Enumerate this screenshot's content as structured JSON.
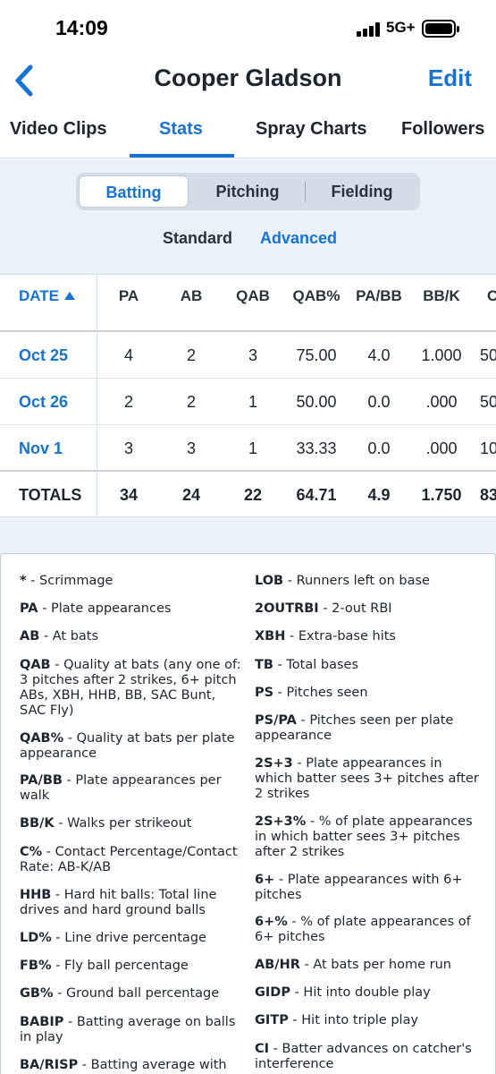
{
  "status_bar": {
    "time": "14:09",
    "network": "5G+"
  },
  "nav": {
    "title": "Cooper Gladson",
    "edit_label": "Edit"
  },
  "tabs": [
    {
      "label": "Video Clips",
      "active": false
    },
    {
      "label": "Stats",
      "active": true
    },
    {
      "label": "Spray Charts",
      "active": false
    },
    {
      "label": "Followers",
      "active": false
    }
  ],
  "stat_types": [
    {
      "label": "Batting",
      "active": true
    },
    {
      "label": "Pitching",
      "active": false
    },
    {
      "label": "Fielding",
      "active": false
    }
  ],
  "modes": {
    "standard": "Standard",
    "advanced": "Advanced",
    "active": "Advanced"
  },
  "table": {
    "columns": [
      "DATE",
      "PA",
      "AB",
      "QAB",
      "QAB%",
      "PA/BB",
      "BB/K",
      "C"
    ],
    "rows": [
      [
        "Oct 25",
        "4",
        "2",
        "3",
        "75.00",
        "4.0",
        "1.000",
        "50"
      ],
      [
        "Oct 26",
        "2",
        "2",
        "1",
        "50.00",
        "0.0",
        ".000",
        "50"
      ],
      [
        "Nov 1",
        "3",
        "3",
        "1",
        "33.33",
        "0.0",
        ".000",
        "10"
      ]
    ],
    "totals": [
      "TOTALS",
      "34",
      "24",
      "22",
      "64.71",
      "4.9",
      "1.750",
      "83"
    ]
  },
  "glossary": {
    "left": [
      {
        "term": "*",
        "def": "Scrimmage"
      },
      {
        "term": "PA",
        "def": "Plate appearances"
      },
      {
        "term": "AB",
        "def": "At bats"
      },
      {
        "term": "QAB",
        "def": "Quality at bats (any one of: 3 pitches after 2 strikes, 6+ pitch ABs, XBH, HHB, BB, SAC Bunt, SAC Fly)"
      },
      {
        "term": "QAB%",
        "def": "Quality at bats per plate appearance"
      },
      {
        "term": "PA/BB",
        "def": "Plate appearances per walk"
      },
      {
        "term": "BB/K",
        "def": "Walks per strikeout"
      },
      {
        "term": "C%",
        "def": "Contact Percentage/Contact Rate: AB-K/AB"
      },
      {
        "term": "HHB",
        "def": "Hard hit balls: Total line drives and hard ground balls"
      },
      {
        "term": "LD%",
        "def": "Line drive percentage"
      },
      {
        "term": "FB%",
        "def": "Fly ball percentage"
      },
      {
        "term": "GB%",
        "def": "Ground ball percentage"
      },
      {
        "term": "BABIP",
        "def": "Batting average on balls in play"
      },
      {
        "term": "BA/RISP",
        "def": "Batting average with"
      }
    ],
    "right": [
      {
        "term": "LOB",
        "def": "Runners left on base"
      },
      {
        "term": "2OUTRBI",
        "def": "2-out RBI"
      },
      {
        "term": "XBH",
        "def": "Extra-base hits"
      },
      {
        "term": "TB",
        "def": "Total bases"
      },
      {
        "term": "PS",
        "def": "Pitches seen"
      },
      {
        "term": "PS/PA",
        "def": "Pitches seen per plate appearance"
      },
      {
        "term": "2S+3",
        "def": "Plate appearances in which batter sees 3+ pitches after 2 strikes"
      },
      {
        "term": "2S+3%",
        "def": "% of plate appearances in which batter sees 3+ pitches after 2 strikes"
      },
      {
        "term": "6+",
        "def": "Plate appearances with 6+ pitches"
      },
      {
        "term": "6+%",
        "def": "% of plate appearances of 6+ pitches"
      },
      {
        "term": "AB/HR",
        "def": "At bats per home run"
      },
      {
        "term": "GIDP",
        "def": "Hit into double play"
      },
      {
        "term": "GITP",
        "def": "Hit into triple play"
      },
      {
        "term": "CI",
        "def": "Batter advances on catcher's interference"
      }
    ]
  }
}
